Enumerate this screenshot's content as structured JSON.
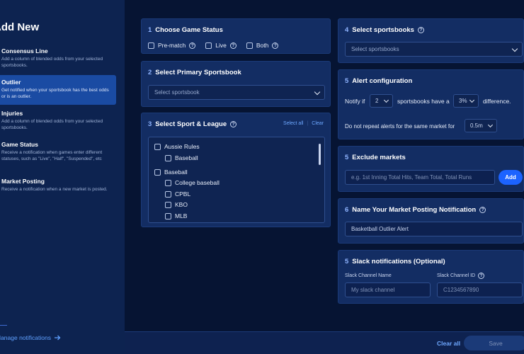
{
  "sidebar": {
    "title": "Add New",
    "items": [
      {
        "title": "Consensus Line",
        "desc": "Add a column of blended odds from your selected sportsbooks.",
        "active": false
      },
      {
        "title": "Outlier",
        "desc": "Get notified when your sportsbook has the best odds or is an outlier.",
        "active": true
      },
      {
        "title": "Injuries",
        "desc": "Add a column of blended odds from your selected sportsbooks.",
        "active": false
      },
      {
        "title": "Game Status",
        "desc": "Receive a notification when games enter different statuses, such as \"Live\", \"Half\", \"Suspended\", etc",
        "active": false
      },
      {
        "title": "Market Posting",
        "desc": "Receive a notification when a new market is posted.",
        "active": false
      }
    ],
    "manage_link": "Manage notifications"
  },
  "game_status": {
    "num": "1",
    "title": "Choose Game Status",
    "options": [
      "Pre-match",
      "Live",
      "Both"
    ]
  },
  "primary_book": {
    "num": "2",
    "title": "Select Primary Sportsbook",
    "placeholder": "Select sportsbook"
  },
  "sport_league": {
    "num": "3",
    "title": "Select Sport & League",
    "select_all": "Select all",
    "clear": "Clear",
    "items": [
      {
        "label": "Aussie Rules",
        "level": 0
      },
      {
        "label": "Baseball",
        "level": 1
      },
      {
        "label": "Baseball",
        "level": 0
      },
      {
        "label": "College baseball",
        "level": 1
      },
      {
        "label": "CPBL",
        "level": 1
      },
      {
        "label": "KBO",
        "level": 1
      },
      {
        "label": "MLB",
        "level": 1
      }
    ]
  },
  "sportsbooks": {
    "num": "4",
    "title": "Select sportsbooks",
    "placeholder": "Select sportsbooks"
  },
  "alert_config": {
    "num": "5",
    "title": "Alert configuration",
    "notify_if": "Notify if",
    "count_value": "2",
    "have_a": "sportsbooks have a",
    "percent_value": "3%",
    "difference": "difference.",
    "repeat_text": "Do not repeat alerts for the same market for",
    "repeat_value": "0.5m"
  },
  "exclude_markets": {
    "num": "5",
    "title": "Exclude markets",
    "placeholder": "e.g. 1st Inning Total Hits, Team Total, Total Runs",
    "add_label": "Add"
  },
  "market_posting": {
    "num": "6",
    "title": "Name Your Market Posting Notification",
    "value": "Basketball Outlier Alert"
  },
  "slack": {
    "num": "5",
    "title": "Slack notifications (Optional)",
    "channel_name_label": "Slack Channel Name",
    "channel_name_placeholder": "My slack channel",
    "channel_id_label": "Slack Channel ID",
    "channel_id_placeholder": "C1234567890"
  },
  "footer": {
    "clear_all": "Clear all",
    "save": "Save"
  }
}
